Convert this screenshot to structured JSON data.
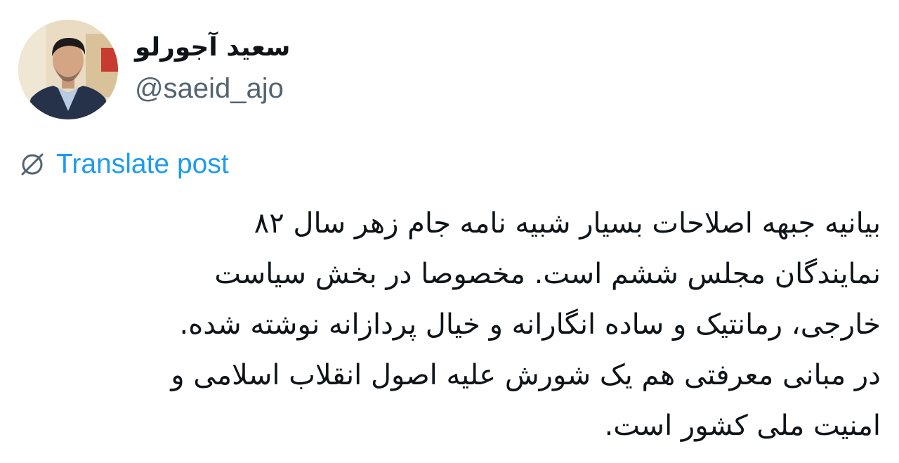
{
  "author": {
    "display_name": "سعید آجورلو",
    "handle": "@saeid_ajo",
    "avatar_icon": "profile-photo"
  },
  "translate": {
    "icon": "globe-translate-icon",
    "label": "Translate post"
  },
  "post": {
    "lines": [
      "بیانیه جبهه اصلاحات بسیار شبیه نامه جام زهر سال ۸۲",
      "نمایندگان مجلس ششم است. مخصوصا در بخش سیاست",
      "خارجی، رمانتیک و ساده انگارانه و خیال پردازانه نوشته شده.",
      "در مبانی معرفتی هم یک شورش علیه اصول انقلاب اسلامی و",
      "امنیت ملی کشور است."
    ]
  },
  "colors": {
    "text": "#0f1419",
    "secondary": "#536471",
    "accent": "#1d9bf0"
  }
}
